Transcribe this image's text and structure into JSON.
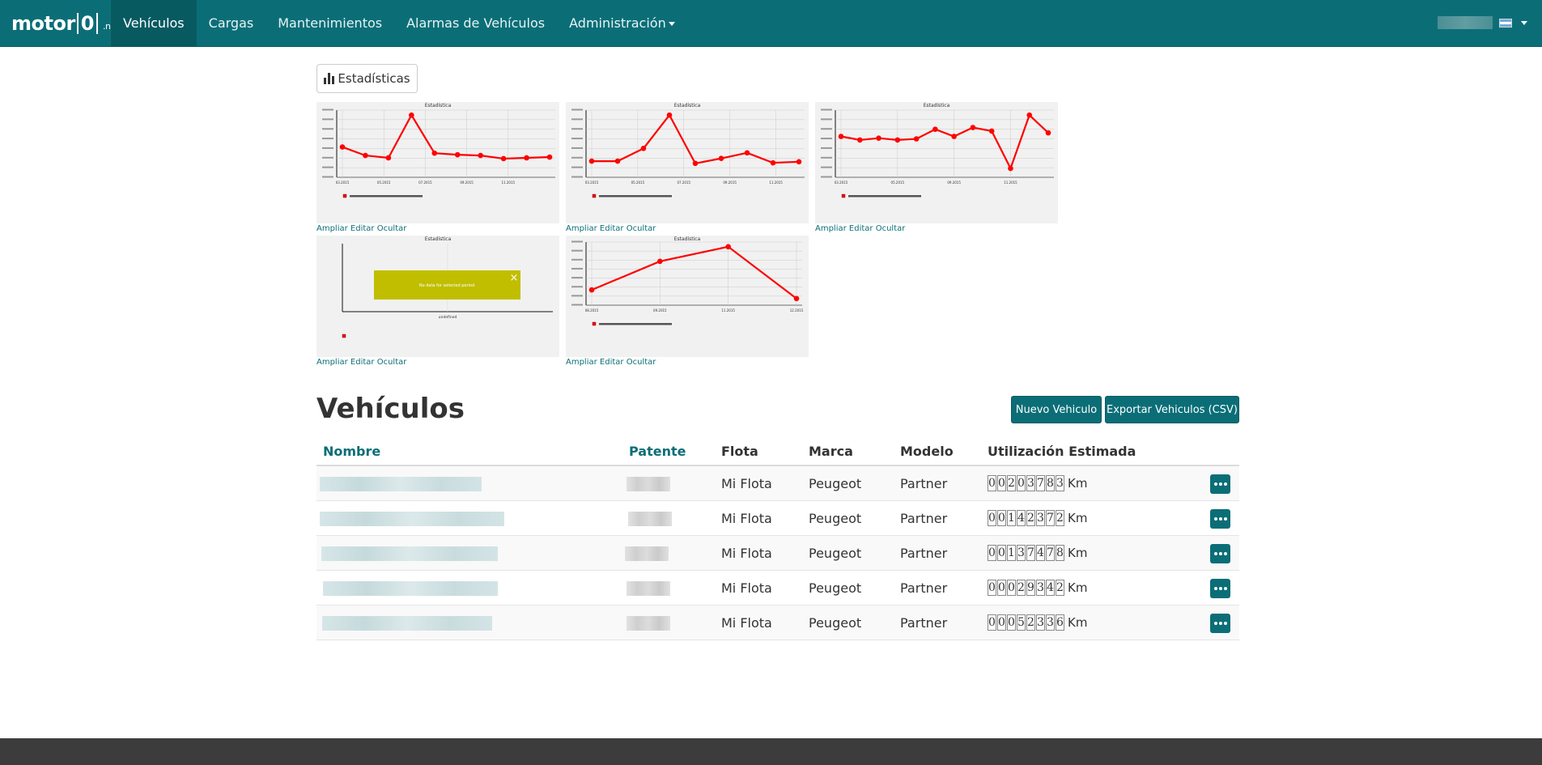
{
  "navbar": {
    "brand_main": "motor",
    "brand_zero": "0",
    "brand_tld": ".net",
    "items": [
      {
        "label": "Vehículos"
      },
      {
        "label": "Cargas"
      },
      {
        "label": "Mantenimientos"
      },
      {
        "label": "Alarmas de Vehículos"
      },
      {
        "label": "Administración"
      }
    ]
  },
  "stats_button": {
    "label": "Estadísticas",
    "icon": "bar-chart-icon"
  },
  "panel_links": {
    "expand": "Ampliar",
    "edit": "Editar",
    "hide": "Ocultar"
  },
  "chart_data": [
    {
      "type": "line",
      "title": "Estadística",
      "x": [
        "03.2015",
        "",
        "05.2015",
        "",
        "07.2015",
        "",
        "09.2015",
        "",
        "11.2015",
        "",
        ""
      ],
      "values": [
        1950,
        1400,
        1250,
        4000,
        1550,
        1450,
        1400,
        1200,
        1250,
        1300
      ],
      "color": "#ff0000"
    },
    {
      "type": "line",
      "title": "Estadística",
      "x": [
        "03.2015",
        "",
        "05.2015",
        "",
        "07.2015",
        "",
        "09.2015",
        "",
        "11.2015",
        ""
      ],
      "values": [
        1450,
        1450,
        2600,
        5600,
        1250,
        1700,
        2200,
        1300,
        1400
      ],
      "color": "#ff0000"
    },
    {
      "type": "line",
      "title": "Estadística",
      "x": [
        "03.2015",
        "",
        "",
        "05.2015",
        "",
        "",
        "09.2015",
        "",
        "",
        "11.2015",
        "",
        ""
      ],
      "values": [
        1150,
        1050,
        1100,
        1050,
        1080,
        1350,
        1150,
        1400,
        1300,
        250,
        1750,
        1250
      ],
      "color": "#ff0000"
    },
    {
      "type": "line",
      "title": "Estadística",
      "x_label": "undefined",
      "message": "No data for selected period",
      "values": []
    },
    {
      "type": "line",
      "title": "Estadística",
      "x": [
        "08.2015",
        "09.2015",
        "11.2015",
        "12.2015"
      ],
      "values": [
        2300,
        6600,
        8800,
        1000
      ],
      "color": "#ff0000"
    }
  ],
  "vehicles": {
    "title": "Vehículos",
    "new_button": "Nuevo Vehiculo",
    "export_button": "Exportar Vehiculos (CSV)",
    "columns": {
      "name": "Nombre",
      "plate": "Patente",
      "fleet": "Flota",
      "brand": "Marca",
      "model": "Modelo",
      "usage": "Utilización Estimada"
    },
    "rows": [
      {
        "fleet": "Mi Flota",
        "brand": "Peugeot",
        "model": "Partner",
        "odometer": [
          "0",
          "0",
          "2",
          "0",
          "3",
          "7",
          "8",
          "3"
        ],
        "unit": "Km"
      },
      {
        "fleet": "Mi Flota",
        "brand": "Peugeot",
        "model": "Partner",
        "odometer": [
          "0",
          "0",
          "1",
          "4",
          "2",
          "3",
          "7",
          "2"
        ],
        "unit": "Km"
      },
      {
        "fleet": "Mi Flota",
        "brand": "Peugeot",
        "model": "Partner",
        "odometer": [
          "0",
          "0",
          "1",
          "3",
          "7",
          "4",
          "7",
          "8"
        ],
        "unit": "Km"
      },
      {
        "fleet": "Mi Flota",
        "brand": "Peugeot",
        "model": "Partner",
        "odometer": [
          "0",
          "0",
          "0",
          "2",
          "9",
          "3",
          "4",
          "2"
        ],
        "unit": "Km"
      },
      {
        "fleet": "Mi Flota",
        "brand": "Peugeot",
        "model": "Partner",
        "odometer": [
          "0",
          "0",
          "0",
          "5",
          "2",
          "3",
          "3",
          "6"
        ],
        "unit": "Km"
      }
    ]
  }
}
